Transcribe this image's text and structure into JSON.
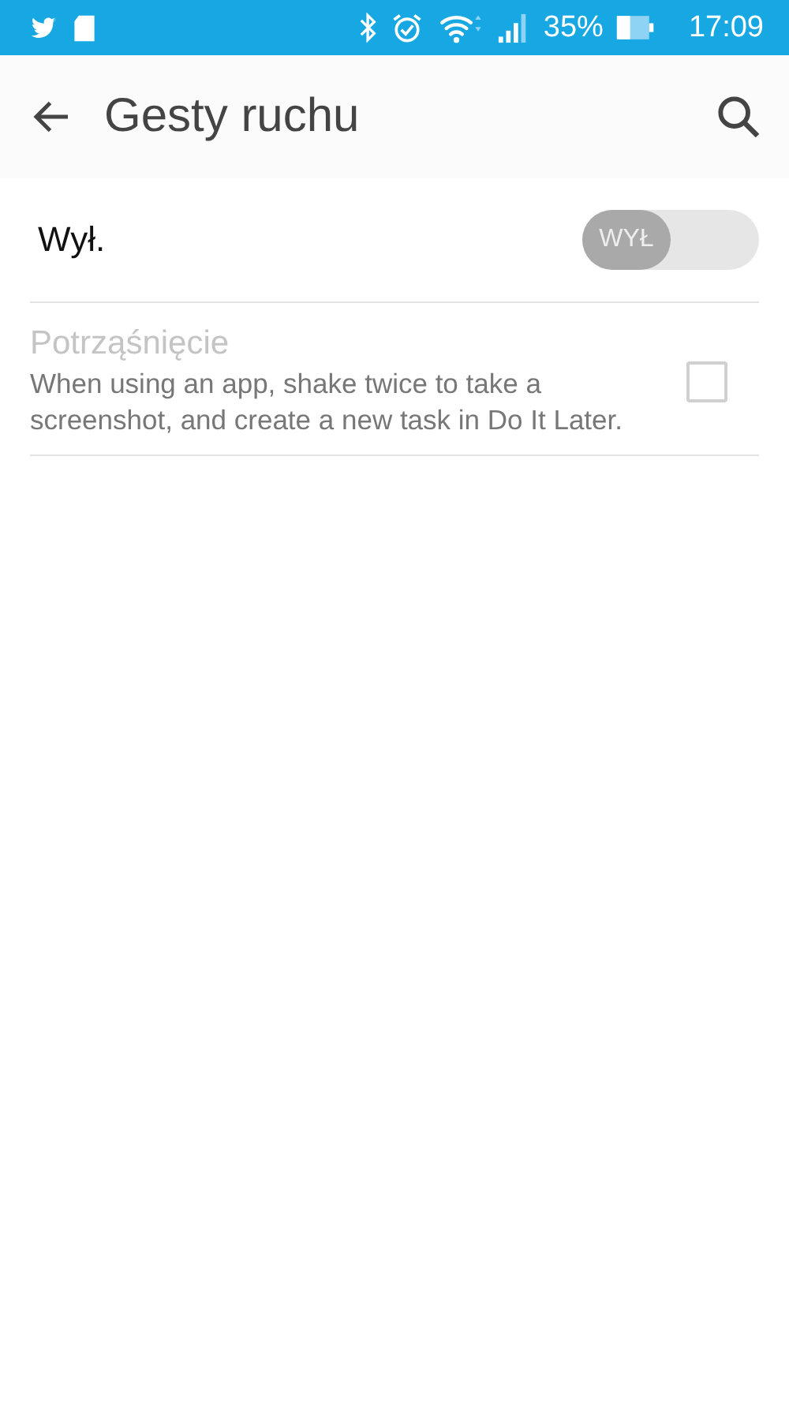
{
  "status_bar": {
    "battery": "35%",
    "time": "17:09"
  },
  "header": {
    "title": "Gesty ruchu"
  },
  "master_switch": {
    "label": "Wył.",
    "on": false,
    "switch_text": "WYŁ"
  },
  "settings": [
    {
      "title": "Potrząśnięcie",
      "description": "When using an app, shake twice to take a screenshot, and create a new task in Do It Later.",
      "checked": false,
      "disabled": true
    }
  ]
}
